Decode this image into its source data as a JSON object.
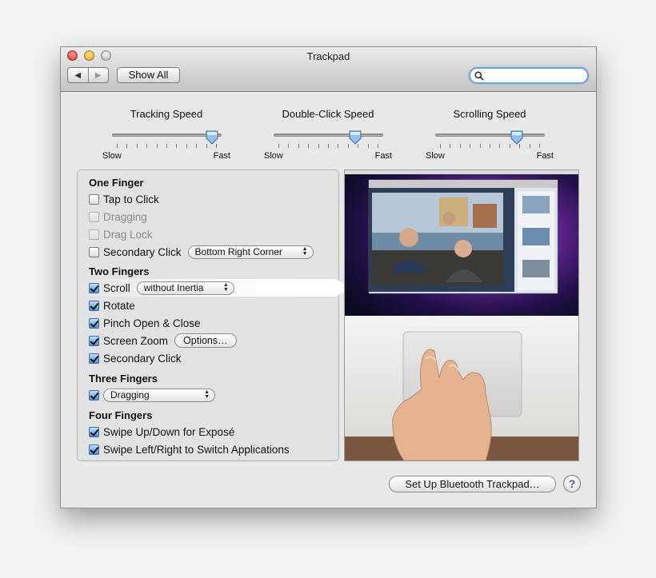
{
  "window": {
    "title": "Trackpad"
  },
  "toolbar": {
    "back": "◀",
    "forward": "▶",
    "show_all": "Show All",
    "search_placeholder": ""
  },
  "sliders": [
    {
      "label": "Tracking Speed",
      "min_label": "Slow",
      "max_label": "Fast",
      "value": 0.97
    },
    {
      "label": "Double-Click Speed",
      "min_label": "Slow",
      "max_label": "Fast",
      "value": 0.78
    },
    {
      "label": "Scrolling Speed",
      "min_label": "Slow",
      "max_label": "Fast",
      "value": 0.78
    }
  ],
  "one_finger": {
    "heading": "One Finger",
    "tap_to_click": "Tap to Click",
    "dragging": "Dragging",
    "drag_lock": "Drag Lock",
    "secondary_click": "Secondary Click",
    "secondary_click_option": "Bottom Right Corner"
  },
  "two_fingers": {
    "heading": "Two Fingers",
    "scroll": "Scroll",
    "scroll_option": "without Inertia",
    "rotate": "Rotate",
    "pinch": "Pinch Open & Close",
    "screen_zoom": "Screen Zoom",
    "options_button": "Options…",
    "secondary_click": "Secondary Click"
  },
  "three_fingers": {
    "heading": "Three Fingers",
    "option": "Dragging"
  },
  "four_fingers": {
    "heading": "Four Fingers",
    "swipe_updown": "Swipe Up/Down for Exposé",
    "swipe_leftright": "Swipe Left/Right to Switch Applications"
  },
  "footer": {
    "bluetooth_button": "Set Up Bluetooth Trackpad…",
    "help": "?"
  },
  "colors": {
    "accent": "#4c8fd6",
    "help": "#6b3fb6"
  }
}
